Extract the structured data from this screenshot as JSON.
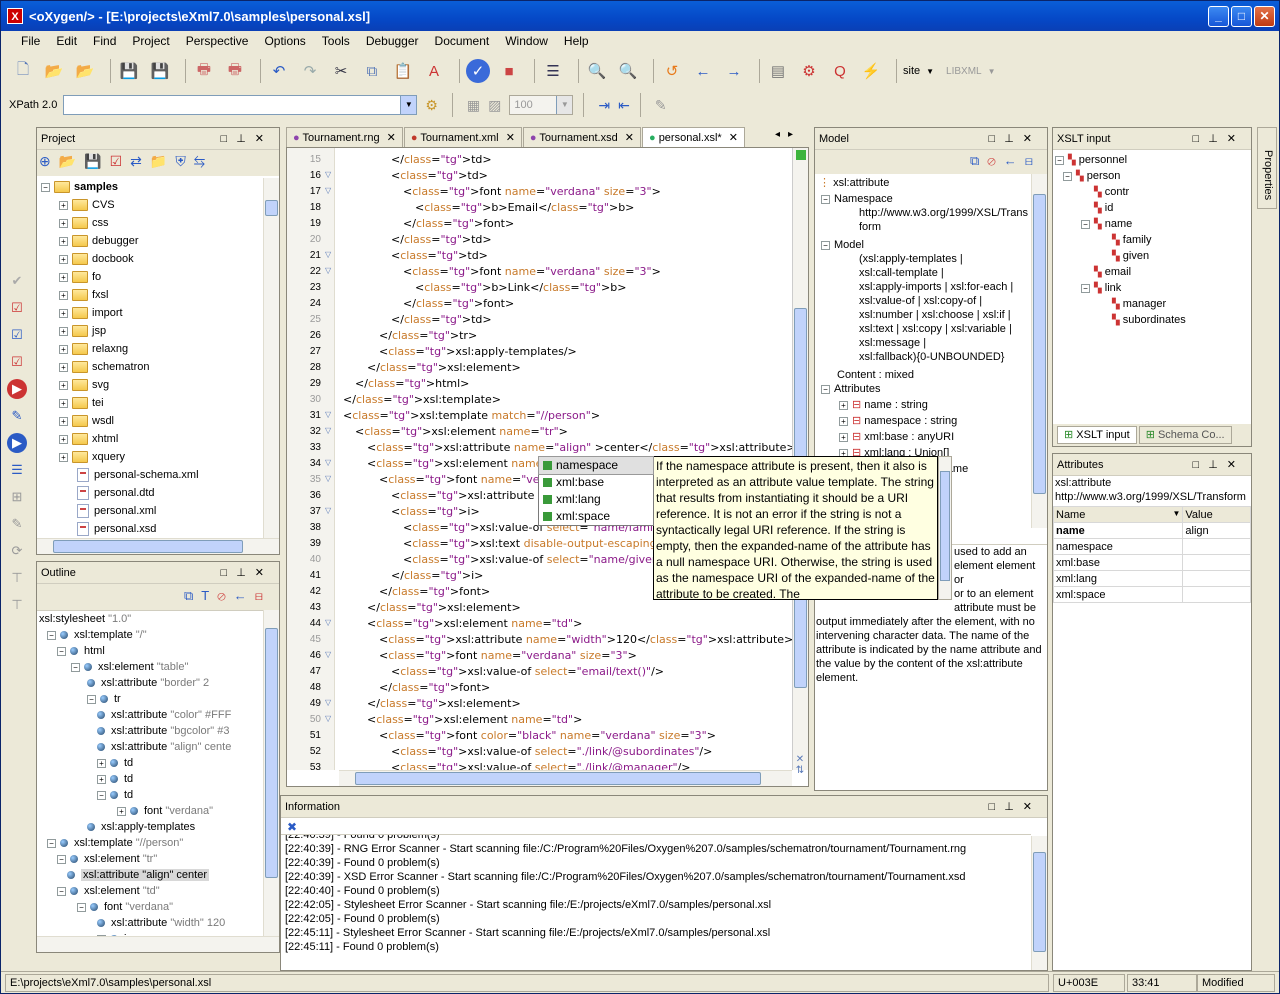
{
  "window": {
    "title": "<oXygen/> - [E:\\projects\\eXml7.0\\samples\\personal.xsl]"
  },
  "menu": [
    "File",
    "Edit",
    "Find",
    "Project",
    "Perspective",
    "Options",
    "Tools",
    "Debugger",
    "Document",
    "Window",
    "Help"
  ],
  "toolbar": {
    "site_label": "site",
    "libxml_label": "LIBXML"
  },
  "xpath": {
    "label": "XPath 2.0",
    "zoom": "100"
  },
  "project": {
    "title": "Project",
    "root": "samples",
    "folders": [
      "CVS",
      "css",
      "debugger",
      "docbook",
      "fo",
      "fxsl",
      "import",
      "jsp",
      "relaxng",
      "schematron",
      "svg",
      "tei",
      "wsdl",
      "xhtml",
      "xquery"
    ],
    "files": [
      "personal-schema.xml",
      "personal.dtd",
      "personal.xml",
      "personal.xsd"
    ]
  },
  "outline": {
    "title": "Outline",
    "rows": [
      {
        "label": "xsl:stylesheet",
        "extra": "\"1.0\""
      },
      {
        "label": "xsl:template",
        "extra": "\"/\""
      },
      {
        "label": "html",
        "extra": ""
      },
      {
        "label": "xsl:element",
        "extra": "\"table\""
      },
      {
        "label": "xsl:attribute",
        "extra": "\"border\" 2"
      },
      {
        "label": "tr",
        "extra": ""
      },
      {
        "label": "xsl:attribute",
        "extra": "\"color\" #FFF"
      },
      {
        "label": "xsl:attribute",
        "extra": "\"bgcolor\" #3"
      },
      {
        "label": "xsl:attribute",
        "extra": "\"align\" cente"
      },
      {
        "label": "td",
        "extra": ""
      },
      {
        "label": "td",
        "extra": ""
      },
      {
        "label": "td",
        "extra": ""
      },
      {
        "label": "font",
        "extra": "\"verdana\""
      },
      {
        "label": "xsl:apply-templates",
        "extra": ""
      },
      {
        "label": "xsl:template",
        "extra": "\"//person\""
      },
      {
        "label": "xsl:element",
        "extra": "\"tr\""
      },
      {
        "label": "xsl:attribute \"align\" center",
        "extra": ""
      },
      {
        "label": "xsl:element",
        "extra": "\"td\""
      },
      {
        "label": "font",
        "extra": "\"verdana\""
      },
      {
        "label": "xsl:attribute",
        "extra": "\"width\" 120"
      },
      {
        "label": "i",
        "extra": ""
      }
    ]
  },
  "tabs": [
    "Tournament.rng",
    "Tournament.xml",
    "Tournament.xsd",
    "personal.xsl*"
  ],
  "editor": {
    "lines": [
      {
        "n": "15",
        "t": "</td>"
      },
      {
        "n": "16",
        "t": "<td>"
      },
      {
        "n": "17",
        "t": "<font name=\"verdana\" size=\"3\">"
      },
      {
        "n": "18",
        "t": "<b>Email</b>"
      },
      {
        "n": "19",
        "t": "</font>"
      },
      {
        "n": "20",
        "t": "</td>"
      },
      {
        "n": "21",
        "t": "<td>"
      },
      {
        "n": "22",
        "t": "<font name=\"verdana\" size=\"3\">"
      },
      {
        "n": "23",
        "t": "<b>Link</b>"
      },
      {
        "n": "24",
        "t": "</font>"
      },
      {
        "n": "25",
        "t": "</td>"
      },
      {
        "n": "26",
        "t": "</tr>"
      },
      {
        "n": "27",
        "t": "<xsl:apply-templates/>"
      },
      {
        "n": "28",
        "t": "</xsl:element>"
      },
      {
        "n": "29",
        "t": "</html>"
      },
      {
        "n": "30",
        "t": "</xsl:template>"
      },
      {
        "n": "31",
        "t": "<xsl:template match=\"//person\">"
      },
      {
        "n": "32",
        "t": "<xsl:element name=\"tr\">"
      },
      {
        "n": "33",
        "t": "<xsl:attribute name=\"align\" >center</xsl:attribute>"
      },
      {
        "n": "34",
        "t": "<xsl:element name=\"td\">"
      },
      {
        "n": "35",
        "t": "<font name=\"verdana\" size"
      },
      {
        "n": "36",
        "t": "<xsl:attribute name=\"widt"
      },
      {
        "n": "37",
        "t": "<i>"
      },
      {
        "n": "38",
        "t": "<xsl:value-of select=\"name/family/text()\"/>"
      },
      {
        "n": "39",
        "t": "<xsl:text disable-output-escaping=\"yes\">&amp;"
      },
      {
        "n": "40",
        "t": "<xsl:value-of select=\"name/given/text()\"/>"
      },
      {
        "n": "41",
        "t": "</i>"
      },
      {
        "n": "42",
        "t": "</font>"
      },
      {
        "n": "43",
        "t": "</xsl:element>"
      },
      {
        "n": "44",
        "t": "<xsl:element name=\"td\">"
      },
      {
        "n": "45",
        "t": "<xsl:attribute name=\"width\">120</xsl:attribute>"
      },
      {
        "n": "46",
        "t": "<font name=\"verdana\" size=\"3\">"
      },
      {
        "n": "47",
        "t": "<xsl:value-of select=\"email/text()\"/>"
      },
      {
        "n": "48",
        "t": "</font>"
      },
      {
        "n": "49",
        "t": "</xsl:element>"
      },
      {
        "n": "50",
        "t": "<xsl:element name=\"td\">"
      },
      {
        "n": "51",
        "t": "<font color=\"black\" name=\"verdana\" size=\"3\">"
      },
      {
        "n": "52",
        "t": "<xsl:value-of select=\"./link/@subordinates\"/>"
      },
      {
        "n": "53",
        "t": "<xsl:value-of select=\"./link/@manager\"/>"
      }
    ]
  },
  "autocomplete": {
    "items": [
      "namespace",
      "xml:base",
      "xml:lang",
      "xml:space"
    ]
  },
  "tooltip": {
    "text": "If the namespace attribute is present, then it also is interpreted as an attribute value template. The string that results from instantiating it should be a URI reference. It is not an error if the string is not a syntactically legal URI reference. If the string is empty, then the expanded-name of the attribute has a null namespace URI. Otherwise, the string is used as the namespace URI of the expanded-name of the attribute to be created. The"
  },
  "model": {
    "title": "Model",
    "element": "xsl:attribute",
    "namespace_label": "Namespace",
    "namespace_value": "http://www.w3.org/1999/XSL/Transform",
    "model_label": "Model",
    "model_lines": [
      "(xsl:apply-templates |",
      "xsl:call-template |",
      "xsl:apply-imports | xsl:for-each |",
      "xsl:value-of | xsl:copy-of |",
      "xsl:number | xsl:choose | xsl:if |",
      "xsl:text | xsl:copy | xsl:variable |",
      "xsl:message |",
      "xsl:fallback){0-UNBOUNDED}"
    ],
    "content": "Content : mixed",
    "attributes_label": "Attributes",
    "attributes": [
      "name : string",
      "namespace : string",
      "xml:base : anyURI",
      "xml:lang : Union[]",
      "xml:space : NCName"
    ],
    "desc_lines": [
      "used to add an",
      "element element or",
      "or to an element",
      "attribute must be",
      "output immediately after the element, with no",
      "intervening character data. The name of the",
      "attribute is indicated by the name attribute and",
      "the value by the content of the xsl:attribute",
      "element."
    ]
  },
  "xslt_input": {
    "title": "XSLT input",
    "nodes": [
      "personnel",
      "person",
      "contr",
      "id",
      "name",
      "family",
      "given",
      "email",
      "link",
      "manager",
      "subordinates"
    ],
    "tabs": [
      "XSLT input",
      "Schema Co..."
    ]
  },
  "attributes_panel": {
    "title": "Attributes",
    "element": "xsl:attribute",
    "ns": "http://www.w3.org/1999/XSL/Transform",
    "col_name": "Name",
    "col_value": "Value",
    "rows": [
      {
        "name": "name",
        "value": "align"
      },
      {
        "name": "namespace",
        "value": ""
      },
      {
        "name": "xml:base",
        "value": ""
      },
      {
        "name": "xml:lang",
        "value": ""
      },
      {
        "name": "xml:space",
        "value": ""
      }
    ]
  },
  "properties_tab": "Properties",
  "information": {
    "title": "Information",
    "lines": [
      "[22:40:39] - Found 0 problem(s)",
      "[22:40:39] - RNG Error Scanner - Start scanning file:/C:/Program%20Files/Oxygen%207.0/samples/schematron/tournament/Tournament.rng",
      "[22:40:39] - Found 0 problem(s)",
      "[22:40:39] - XSD Error Scanner - Start scanning file:/C:/Program%20Files/Oxygen%207.0/samples/schematron/tournament/Tournament.xsd",
      "[22:40:40] - Found 0 problem(s)",
      "[22:42:05] - Stylesheet Error Scanner - Start scanning file:/E:/projects/eXml7.0/samples/personal.xsl",
      "[22:42:05] - Found 0 problem(s)",
      "[22:45:11] - Stylesheet Error Scanner - Start scanning file:/E:/projects/eXml7.0/samples/personal.xsl",
      "[22:45:11] - Found 0 problem(s)"
    ]
  },
  "status": {
    "path": "E:\\projects\\eXml7.0\\samples\\personal.xsl",
    "char": "U+003E",
    "pos": "33:41",
    "state": "Modified"
  }
}
